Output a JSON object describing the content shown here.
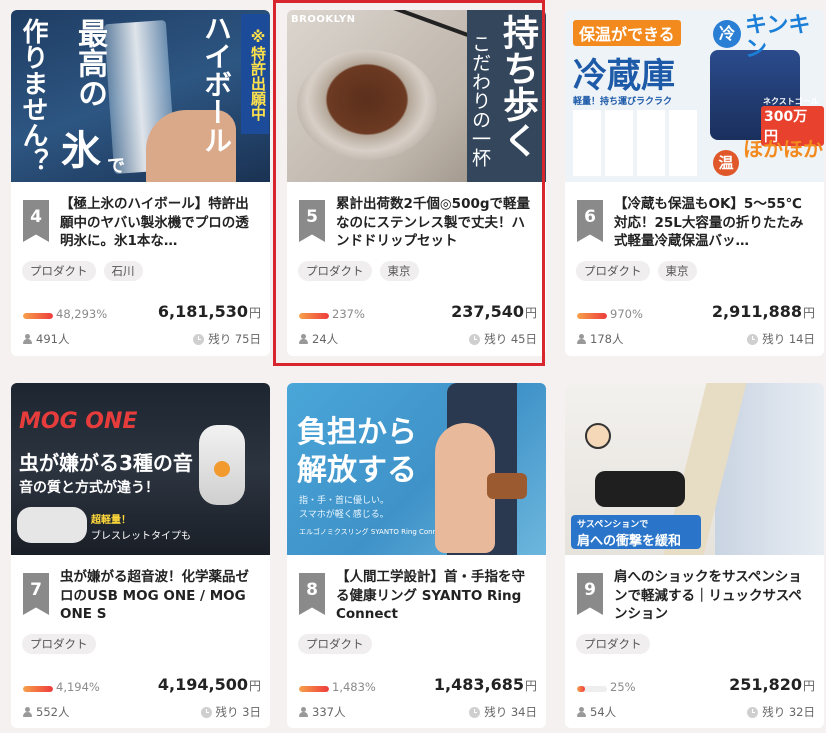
{
  "cards": [
    {
      "rank": "4",
      "title": "【極上氷のハイボール】特許出願中のヤバい製氷機でプロの透明氷に。氷1本な…",
      "tags": [
        "プロダクト",
        "石川"
      ],
      "percent": "48,293%",
      "percent_value": 48293,
      "amount": "6,181,530",
      "yen": "円",
      "people": "491人",
      "remaining": "残り 75日",
      "image": {
        "texts": [
          "最高の",
          "氷",
          "で",
          "作りません？",
          "ハイボール",
          "※特許出願中"
        ]
      }
    },
    {
      "rank": "5",
      "title": "累計出荷数2千個◎500gで軽量なのにステンレス製で丈夫！ハンドドリップセット",
      "tags": [
        "プロダクト",
        "東京"
      ],
      "percent": "237%",
      "percent_value": 237,
      "amount": "237,540",
      "yen": "円",
      "people": "24人",
      "remaining": "残り 45日",
      "image": {
        "texts": [
          "BROOKLYN",
          "持ち歩く",
          "こだわりの一杯"
        ]
      }
    },
    {
      "rank": "6",
      "title": "【冷蔵も保温もOK】5〜55℃対応！25L大容量の折りたたみ式軽量冷蔵保温バッ…",
      "tags": [
        "プロダクト",
        "東京"
      ],
      "percent": "970%",
      "percent_value": 970,
      "amount": "2,911,888",
      "yen": "円",
      "people": "178人",
      "remaining": "残り 14日",
      "image": {
        "texts": [
          "保温ができる",
          "冷蔵庫",
          "軽量！持ち運びラクラク",
          "冷",
          "キンキン",
          "ネクストゴール",
          "300万円",
          "温",
          "ほかほか"
        ]
      }
    },
    {
      "rank": "7",
      "title": "虫が嫌がる超音波！化学薬品ゼロのUSB MOG ONE / MOG ONE S",
      "tags": [
        "プロダクト"
      ],
      "percent": "4,194%",
      "percent_value": 4194,
      "amount": "4,194,500",
      "yen": "円",
      "people": "552人",
      "remaining": "残り 3日",
      "image": {
        "texts": [
          "MOG ONE",
          "虫が嫌がる3種の音",
          "音の質と方式が違う！",
          "超軽量！",
          "ブレスレットタイプも"
        ]
      }
    },
    {
      "rank": "8",
      "title": "【人間工学設計】首・手指を守る健康リング SYANTO Ring Connect",
      "tags": [
        "プロダクト"
      ],
      "percent": "1,483%",
      "percent_value": 1483,
      "amount": "1,483,685",
      "yen": "円",
      "people": "337人",
      "remaining": "残り 34日",
      "image": {
        "texts": [
          "負担から",
          "解放する",
          "指・手・首に優しい。",
          "スマホが軽く感じる。",
          "エルゴノミクスリング SYANTO Ring Connect"
        ]
      }
    },
    {
      "rank": "9",
      "title": "肩へのショックをサスペンションで軽減する｜リュックサスペンション",
      "tags": [
        "プロダクト"
      ],
      "percent": "25%",
      "percent_value": 25,
      "amount": "251,820",
      "yen": "円",
      "people": "54人",
      "remaining": "残り 32日",
      "image": {
        "texts": [
          "サスペンションで",
          "肩への衝撃を緩和"
        ]
      }
    }
  ]
}
